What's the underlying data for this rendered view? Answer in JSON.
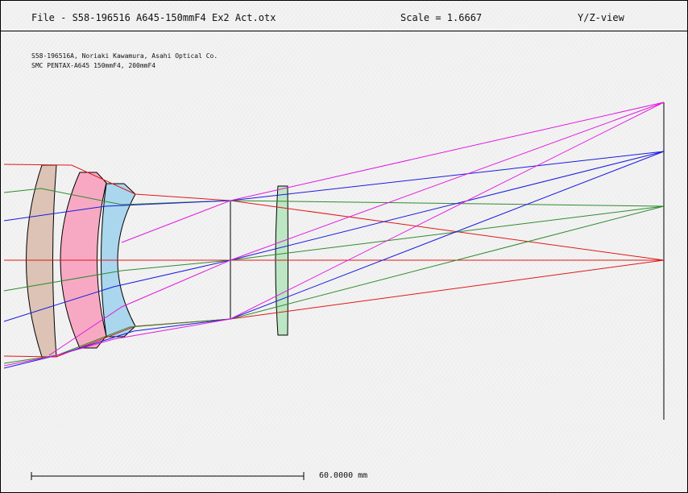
{
  "header": {
    "file": "File - S58-196516 A645-150mmF4 Ex2 Act.otx",
    "scale": "Scale = 1.6667",
    "view": "Y/Z-view"
  },
  "description": {
    "line1": "S58-196516A, Noriaki Kawamura, Asahi Optical Co.",
    "line2": "SMC PENTAX-A645 150mmF4, 200mmF4"
  },
  "scale_bar": {
    "label": "60.0000 mm"
  },
  "colors": {
    "lens1": "#dcc3b5",
    "lens2": "#f7a9c3",
    "lens3": "#aad6ee",
    "lens4": "#bde6c4",
    "ray_axis": "#e01818",
    "ray_mid": "#2e8b2e",
    "ray_high": "#1a1ae0",
    "ray_edge": "#e018e0"
  }
}
